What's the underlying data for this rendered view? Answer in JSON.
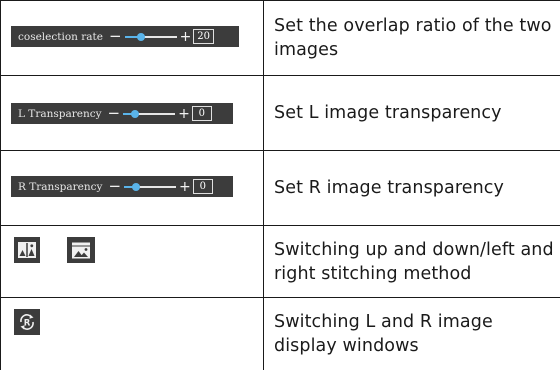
{
  "rows": [
    {
      "control": {
        "label": "coselection rate",
        "minus": "−",
        "plus": "+",
        "value": "20",
        "slider_fraction": 0.3
      },
      "description": "Set the overlap ratio of the two images"
    },
    {
      "control": {
        "label": "L Transparency",
        "minus": "−",
        "plus": "+",
        "value": "0",
        "slider_fraction": 0.2
      },
      "description": "Set L image transparency"
    },
    {
      "control": {
        "label": "R Transparency",
        "minus": "−",
        "plus": "+",
        "value": "0",
        "slider_fraction": 0.2
      },
      "description": "Set R image transparency"
    },
    {
      "icons": [
        "split-vertical-layout-icon",
        "split-horizontal-layout-icon"
      ],
      "description": "Switching up and down/left and right stitching method"
    },
    {
      "icons": [
        "swap-lr-windows-icon"
      ],
      "icon_letter": "R",
      "description": "Switching L and R image display windows"
    }
  ],
  "colors": {
    "control_bg": "#3c3c3c",
    "slider_accent": "#5ab4ea",
    "text": "#1a1a1a",
    "border": "#1a1a1a"
  }
}
